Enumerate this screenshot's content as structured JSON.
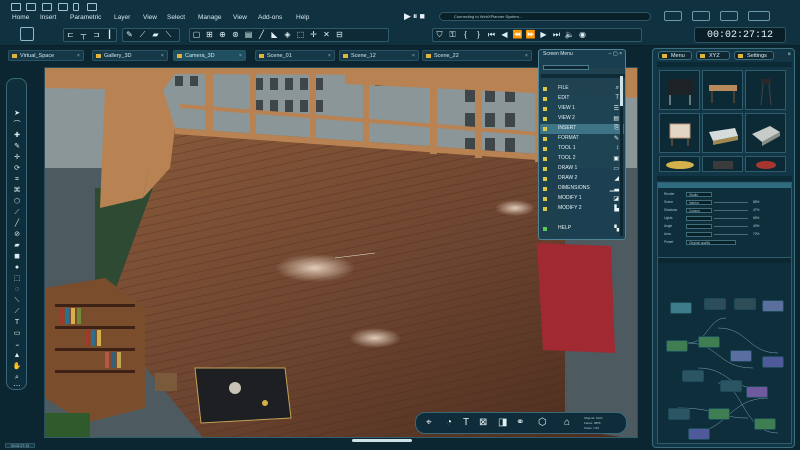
{
  "menubar": {
    "items": [
      "Home",
      "Insert",
      "Parametric",
      "Layer",
      "View",
      "Select",
      "Manage",
      "View",
      "Add-ons",
      "Help"
    ],
    "status_text": "Connecting to WebXPlanner System...",
    "timecode": "00:02:27:12"
  },
  "tabs": [
    "Virtual_Space",
    "Gallery_3D",
    "Camera_3D",
    "Scene_01",
    "Scene_12",
    "Scene_22"
  ],
  "screen_menu": {
    "title": "Screen Menu",
    "items": [
      "FILE",
      "EDIT",
      "VIEW 1",
      "VIEW 2",
      "INSERT",
      "FORMAT",
      "TOOL 1",
      "TOOL 2",
      "DRAW 1",
      "DRAW 2",
      "DIMENSIONS",
      "MODIFY 1",
      "MODIFY 2",
      "",
      "HELP"
    ]
  },
  "right_panel": {
    "tabs": [
      "Menu",
      "XYZ",
      "Settings"
    ],
    "settings_rows": [
      {
        "label": "Render",
        "value": "Studio"
      },
      {
        "label": "Scene",
        "value": "Interior",
        "pct": "85%"
      },
      {
        "label": "Shadows",
        "value": "Custom",
        "pct": "47%"
      },
      {
        "label": "Lights",
        "value": "",
        "pct": "65%"
      },
      {
        "label": "Angle",
        "value": "",
        "pct": "40%"
      },
      {
        "label": "Area",
        "value": "",
        "pct": "72%"
      },
      {
        "label": "Preset",
        "value": "Original quality",
        "pct": ""
      }
    ]
  },
  "bottom_bar": {
    "icons": [
      "camera-icon",
      "paint-icon",
      "text-icon",
      "frame-icon",
      "tag-icon",
      "link-icon",
      "cube-icon",
      "lock-icon"
    ],
    "info_lines": [
      "Objects: 1024",
      "Faces: 3856",
      "Scale: 1:50"
    ]
  },
  "bottom_left_time": "00:02:27:12"
}
